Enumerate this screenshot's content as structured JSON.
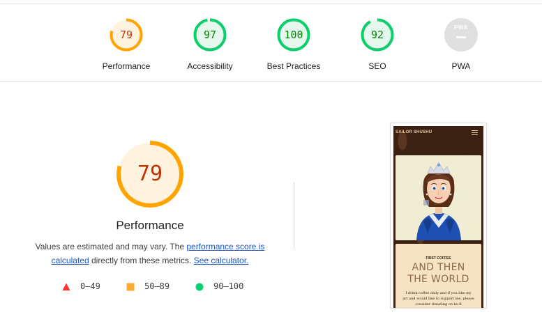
{
  "categories": [
    {
      "id": "performance",
      "label": "Performance",
      "score": "79",
      "fraction": 0.79,
      "color": "#ffa400",
      "fill": "#fff3e0",
      "text_color": "#c33300"
    },
    {
      "id": "accessibility",
      "label": "Accessibility",
      "score": "97",
      "fraction": 0.97,
      "color": "#0cce6b",
      "fill": "#e6f8ee",
      "text_color": "#008800"
    },
    {
      "id": "best-practices",
      "label": "Best Practices",
      "score": "100",
      "fraction": 1.0,
      "color": "#0cce6b",
      "fill": "#e6f8ee",
      "text_color": "#008800"
    },
    {
      "id": "seo",
      "label": "SEO",
      "score": "92",
      "fraction": 0.92,
      "color": "#0cce6b",
      "fill": "#e6f8ee",
      "text_color": "#008800"
    },
    {
      "id": "pwa",
      "label": "PWA",
      "badge_text": "PWA"
    }
  ],
  "main": {
    "score": "79",
    "fraction": 0.79,
    "title": "Performance",
    "desc_prefix": "Values are estimated and may vary. The ",
    "desc_link1": "performance score is calculated",
    "desc_middle": " directly from these metrics. ",
    "desc_link2": "See calculator."
  },
  "legend": [
    {
      "shape": "triangle",
      "color": "#ff3333",
      "label": "0–49"
    },
    {
      "shape": "square",
      "color": "#ffaa33",
      "label": "50–89"
    },
    {
      "shape": "circle",
      "color": "#0cce6b",
      "label": "90–100"
    }
  ],
  "screenshot": {
    "site_title": "SAILOR SHUSHU",
    "kicker": "FIRST COFFEE",
    "headline_1": "AND THEN",
    "headline_2": "THE WORLD",
    "body": "I drink coffee daily and if you like my art and would like to support me, please consider donating on ko-fi"
  },
  "icons": {
    "menu": "hamburger-menu-icon",
    "fail": "triangle-icon",
    "average": "square-icon",
    "pass": "circle-icon"
  }
}
